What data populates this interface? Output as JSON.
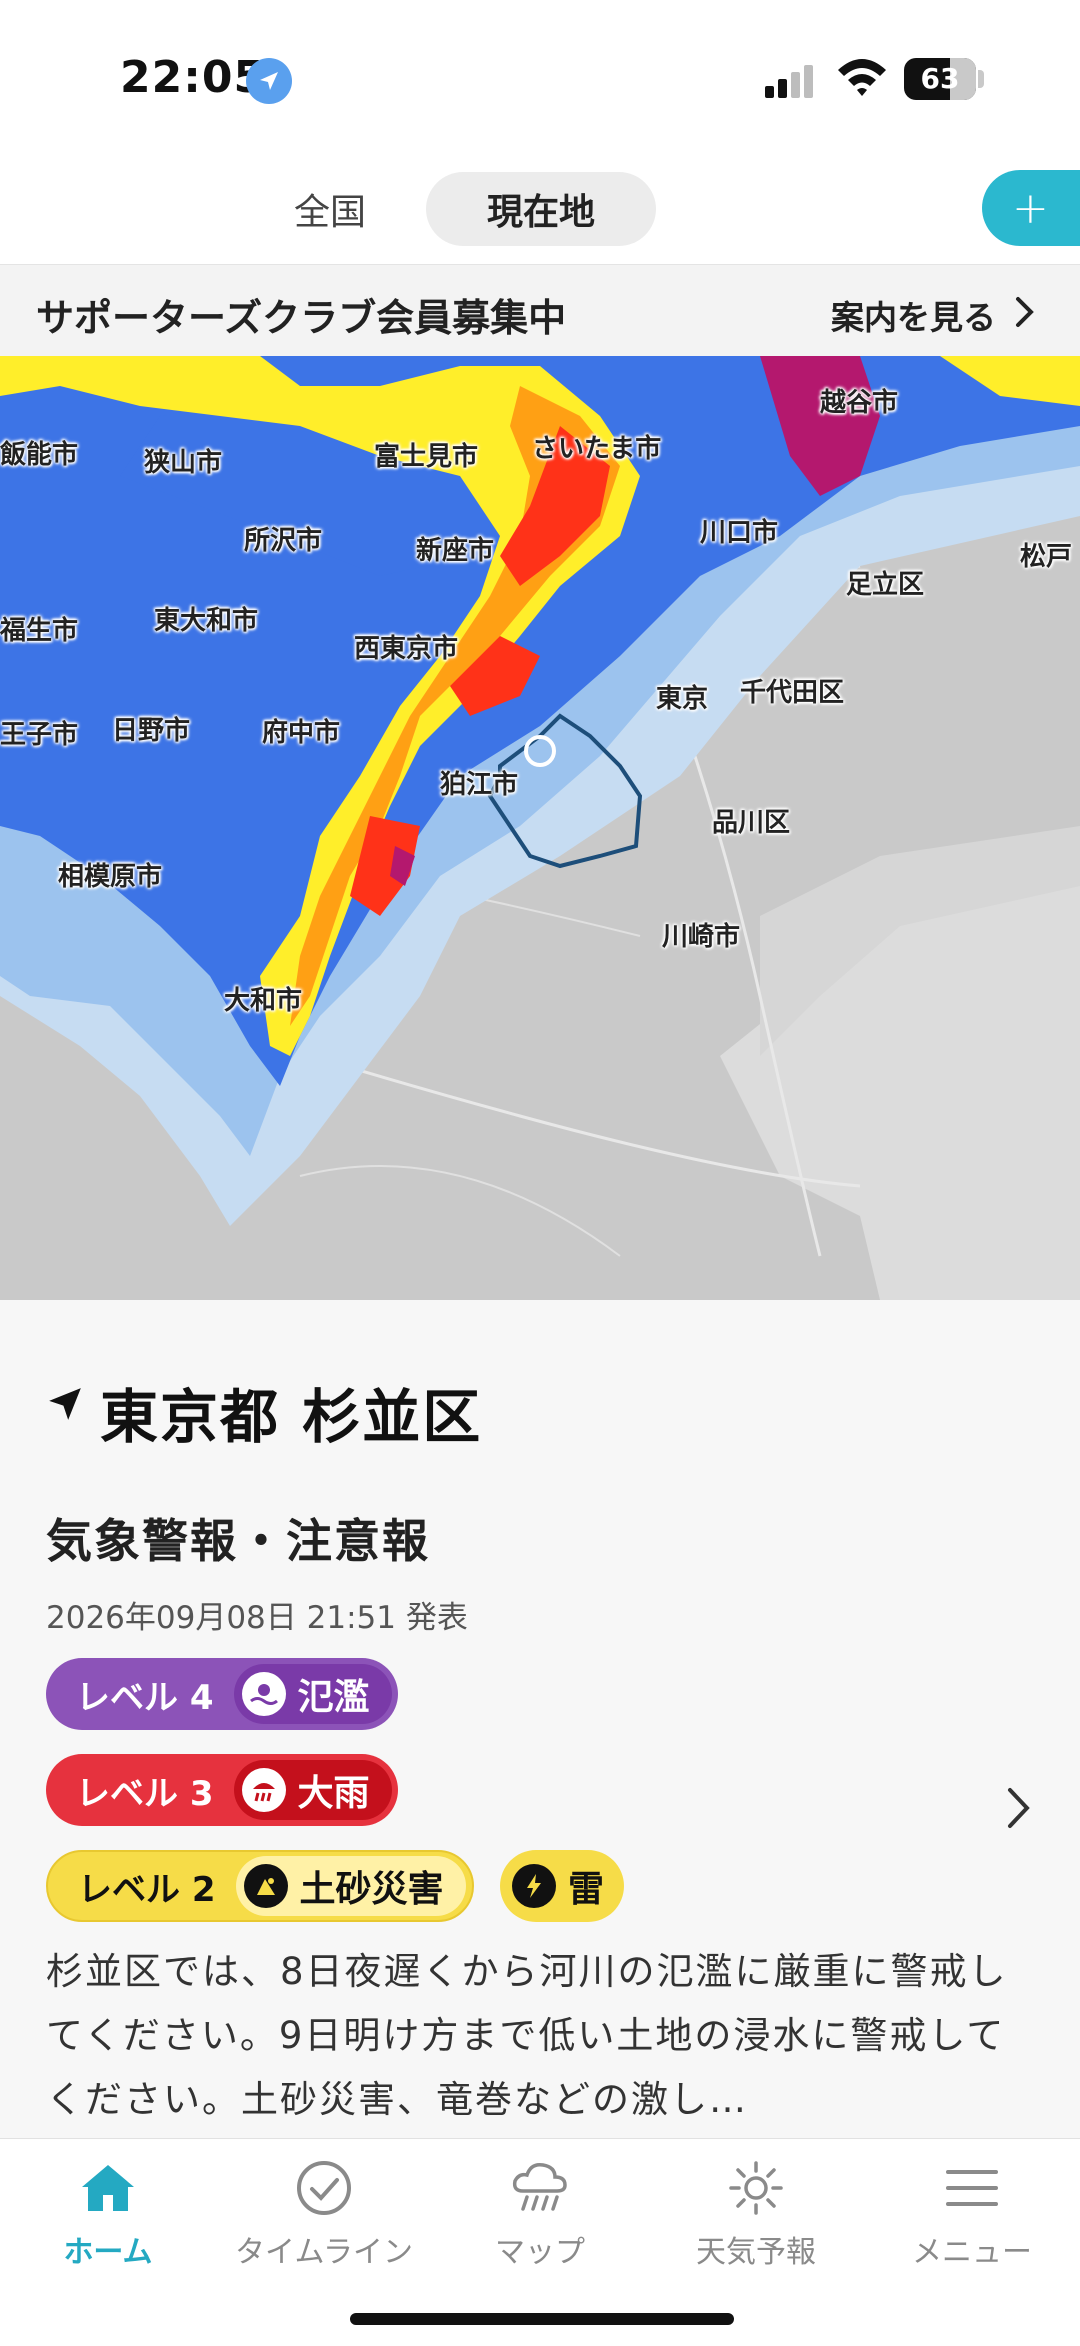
{
  "status_bar": {
    "time": "22:05",
    "battery": "63"
  },
  "tabs": {
    "zenkoku": "全国",
    "genzaichi": "現在地",
    "add": "+"
  },
  "banner": {
    "title": "サポーターズクラブ会員募集中",
    "link": "案内を見る"
  },
  "map": {
    "labels": {
      "hanno": "飯能市",
      "sayama": "狭山市",
      "fujimi": "富士見市",
      "saitama": "さいたま市",
      "koshigaya": "越谷市",
      "tokorozawa": "所沢市",
      "niiza": "新座市",
      "kawaguchi": "川口市",
      "matsudo": "松戸",
      "adachi": "足立区",
      "fussa": "福生市",
      "higashiyamato": "東大和市",
      "nishitokyo": "西東京市",
      "tokyo": "東京",
      "chiyoda": "千代田区",
      "hachioji": "王子市",
      "hino": "日野市",
      "fuchu": "府中市",
      "komae": "狛江市",
      "shinagawa": "品川区",
      "sagamihara": "相模原市",
      "kawasaki": "川崎市",
      "yamato": "大和市"
    },
    "colors": {
      "level1": "#c6dcf2",
      "level2": "#9cc3ee",
      "level3": "#3d74e6",
      "level4": "#ffee2a",
      "level5": "#ffa014",
      "level6": "#ff3218",
      "level7": "#b4186e"
    }
  },
  "location": {
    "title": "東京都 杉並区"
  },
  "warnings": {
    "title": "気象警報・注意報",
    "issued": "2026年09月08日 21:51 発表",
    "level4": {
      "level": "レベル 4",
      "label": "氾濫",
      "color": "#8c53b8"
    },
    "level3": {
      "level": "レベル 3",
      "label": "大雨",
      "color": "#e6323e"
    },
    "level2": {
      "level": "レベル 2",
      "label": "土砂災害",
      "color": "#f6dc48"
    },
    "thunder": {
      "label": "雷"
    },
    "description": "杉並区では、8日夜遅くから河川の氾濫に厳重に警戒してください。9日明け方まで低い土地の浸水に警戒してください。土砂災害、竜巻などの激し…"
  },
  "nav": [
    {
      "label": "ホーム",
      "icon": "home-icon"
    },
    {
      "label": "タイムライン",
      "icon": "timeline-icon"
    },
    {
      "label": "マップ",
      "icon": "rain-cloud-icon"
    },
    {
      "label": "天気予報",
      "icon": "sun-icon"
    },
    {
      "label": "メニュー",
      "icon": "menu-icon"
    }
  ]
}
